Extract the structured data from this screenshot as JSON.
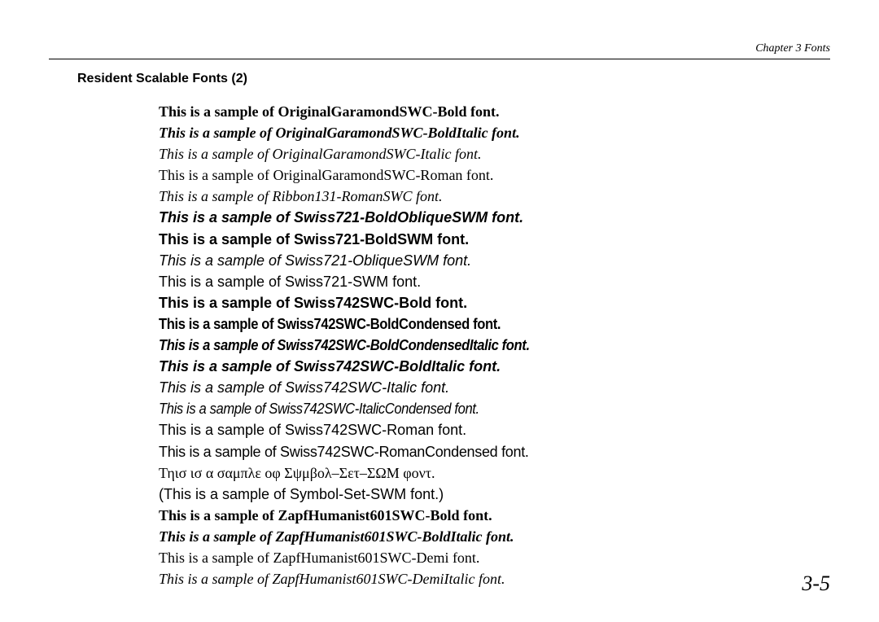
{
  "chapter": "Chapter 3 Fonts",
  "section_title": "Resident Scalable Fonts (2)",
  "page_number": "3-5",
  "samples": [
    {
      "text": "This is a sample of OriginalGaramondSWC-Bold font.",
      "cls": "serif bold"
    },
    {
      "text": "This is a sample of OriginalGaramondSWC-BoldItalic font.",
      "cls": "serif bold italic"
    },
    {
      "text": "This is a sample of OriginalGaramondSWC-Italic font.",
      "cls": "serif italic"
    },
    {
      "text": "This is a sample of OriginalGaramondSWC-Roman font.",
      "cls": "serif"
    },
    {
      "text": "This is a sample of Ribbon131-RomanSWC font.",
      "cls": "script italic"
    },
    {
      "text": "This is a sample of Swiss721-BoldObliqueSWM font.",
      "cls": "sans bold italic"
    },
    {
      "text": "This is a sample of Swiss721-BoldSWM font.",
      "cls": "sans bold"
    },
    {
      "text": "This is a sample of Swiss721-ObliqueSWM font.",
      "cls": "sans italic"
    },
    {
      "text": "This is a sample of Swiss721-SWM font.",
      "cls": "sans"
    },
    {
      "text": "This is a sample of Swiss742SWC-Bold font.",
      "cls": "sans bold"
    },
    {
      "text": "This is a sample of Swiss742SWC-BoldCondensed font.",
      "cls": "sans bold cond"
    },
    {
      "text": "This is a sample of Swiss742SWC-BoldCondensedItalic font.",
      "cls": "sans bold italic cond"
    },
    {
      "text": "This is a sample of Swiss742SWC-BoldItalic font.",
      "cls": "sans bold italic"
    },
    {
      "text": "This is a sample of Swiss742SWC-Italic font.",
      "cls": "sans italic"
    },
    {
      "text": "This is a sample of Swiss742SWC-ItalicCondensed font.",
      "cls": "sans italic cond small"
    },
    {
      "text": "This is a sample of Swiss742SWC-Roman font.",
      "cls": "sans"
    },
    {
      "text": "This is a sample of Swiss742SWC-RomanCondensed font.",
      "cls": "sans narrow small"
    },
    {
      "text": "Τηισ ισ α σαμπλε οφ Σψμβολ–Σετ–ΣΩΜ φοντ.",
      "cls": "serif"
    },
    {
      "text": "(This is a sample of Symbol-Set-SWM font.)",
      "cls": "sans"
    },
    {
      "text": "This is a sample of ZapfHumanist601SWC-Bold font.",
      "cls": "serif bold"
    },
    {
      "text": "This is a sample of ZapfHumanist601SWC-BoldItalic font.",
      "cls": "serif bold italic"
    },
    {
      "text": "This is a sample of ZapfHumanist601SWC-Demi font.",
      "cls": "serif"
    },
    {
      "text": "This is a sample of ZapfHumanist601SWC-DemiItalic font.",
      "cls": "serif italic"
    }
  ]
}
